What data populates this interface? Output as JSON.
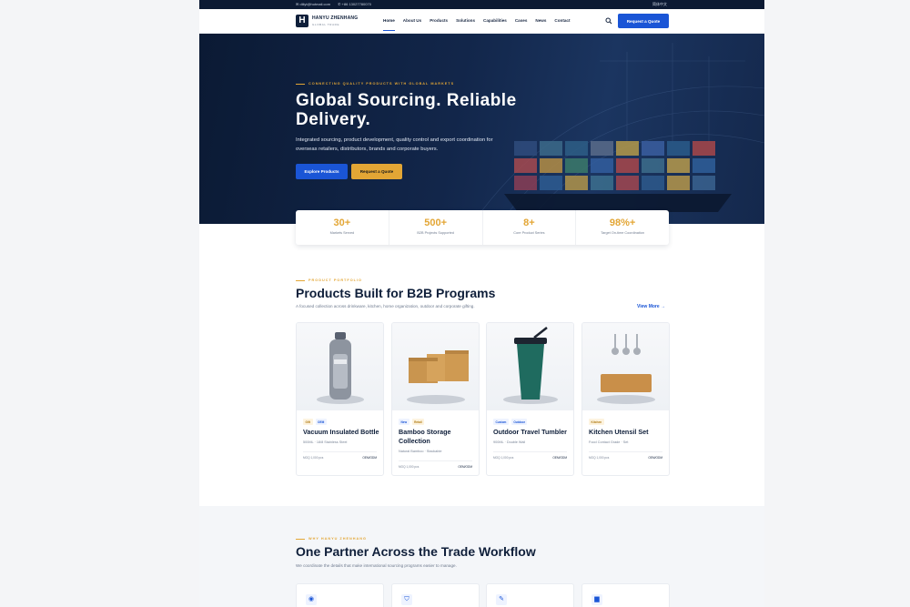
{
  "topbar": {
    "email": "✉ diliyt@hotmail.com",
    "phone": "✆ +86 13027780070",
    "language": "简体中文"
  },
  "nav": {
    "brand": "HANYU ZHENHANG",
    "brand_sub": "GLOBAL TRADE",
    "logo_letter": "H",
    "items": [
      "Home",
      "About Us",
      "Products",
      "Solutions",
      "Capabilities",
      "Cases",
      "News",
      "Contact"
    ],
    "active": "Home",
    "quote_label": "Request a Quote",
    "search_icon": "search-icon"
  },
  "hero": {
    "eyebrow": "CONNECTING QUALITY PRODUCTS WITH GLOBAL MARKETS",
    "title": "Global Sourcing. Reliable Delivery.",
    "description": "Integrated sourcing, product development, quality control and export coordination for overseas retailers, distributors, brands and corporate buyers.",
    "primary_cta": "Explore Products",
    "secondary_cta": "Request a Quote"
  },
  "stats": [
    {
      "value": "30+",
      "label": "Markets Served"
    },
    {
      "value": "500+",
      "label": "B2B Projects Supported"
    },
    {
      "value": "8+",
      "label": "Core Product Series"
    },
    {
      "value": "98%+",
      "label": "Target On-time Coordination"
    }
  ],
  "products": {
    "eyebrow": "PRODUCT PORTFOLIO",
    "title": "Products Built for B2B Programs",
    "subtitle": "A focused collection across drinkware, kitchen, home organization, outdoor and corporate gifting.",
    "view_more": "View More →",
    "cards": [
      {
        "tags": [
          "Gift",
          "OEM"
        ],
        "name": "Vacuum Insulated Bottle",
        "spec": "500ML · 18/8 Stainless Steel",
        "moq": "MOQ 1,000 pcs",
        "oem": "OEM/ODM"
      },
      {
        "tags": [
          "New",
          "Retail"
        ],
        "name": "Bamboo Storage Collection",
        "spec": "Natural Bamboo · Stackable",
        "moq": "MOQ 1,000 pcs",
        "oem": "OEM/ODM"
      },
      {
        "tags": [
          "Custom",
          "Outdoor"
        ],
        "name": "Outdoor Travel Tumbler",
        "spec": "900ML · Double Wall",
        "moq": "MOQ 1,000 pcs",
        "oem": "OEM/ODM"
      },
      {
        "tags": [
          "Kitchen"
        ],
        "name": "Kitchen Utensil Set",
        "spec": "Food Contact Grade · Set",
        "moq": "MOQ 1,000 pcs",
        "oem": "OEM/ODM"
      }
    ]
  },
  "workflow": {
    "eyebrow": "WHY HANYU ZHENHANG",
    "title": "One Partner Across the Trade Workflow",
    "subtitle": "We coordinate the details that make international sourcing programs easier to manage.",
    "icons": [
      "globe-icon",
      "shield-icon",
      "checklist-icon",
      "truck-icon"
    ],
    "icon_glyphs": [
      "◉",
      "⛉",
      "✎",
      "▆"
    ]
  },
  "colors": {
    "navy": "#0f1f3a",
    "accent_blue": "#1a55d6",
    "gold": "#e3a635"
  }
}
